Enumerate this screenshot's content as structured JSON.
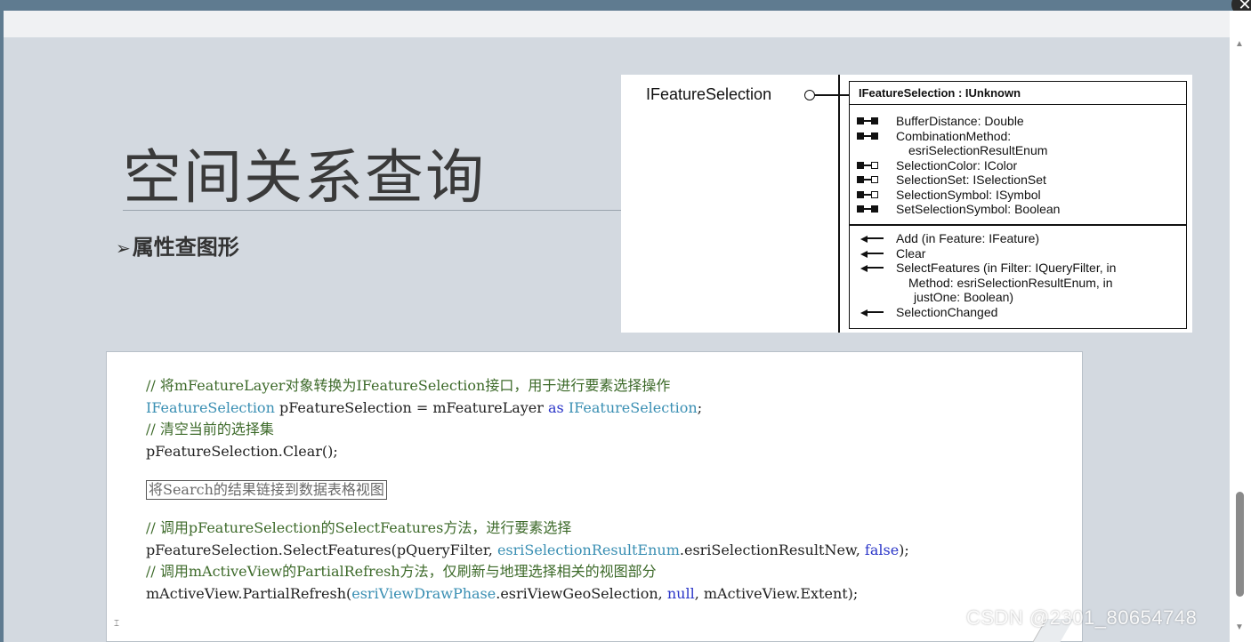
{
  "slide": {
    "title": "空间关系查询",
    "subtitle": "属性查图形",
    "subtitle_marker": "➢"
  },
  "uml": {
    "interface_name": "IFeatureSelection",
    "header": "IFeatureSelection : IUnknown",
    "properties": [
      {
        "text": "BufferDistance: Double",
        "glyph": "read-write"
      },
      {
        "text": "CombinationMethod:",
        "glyph": "read-write"
      },
      {
        "text": "esriSelectionResultEnum",
        "glyph": "none",
        "continuation": true
      },
      {
        "text": "SelectionColor: IColor",
        "glyph": "read-only"
      },
      {
        "text": "SelectionSet: ISelectionSet",
        "glyph": "read-only"
      },
      {
        "text": "SelectionSymbol: ISymbol",
        "glyph": "read-only"
      },
      {
        "text": "SetSelectionSymbol: Boolean",
        "glyph": "read-write"
      }
    ],
    "methods": [
      {
        "text": "Add (in Feature: IFeature)",
        "glyph": "method"
      },
      {
        "text": "Clear",
        "glyph": "method"
      },
      {
        "text": "SelectFeatures (in Filter: IQueryFilter, in",
        "glyph": "method"
      },
      {
        "text": "Method: esriSelectionResultEnum, in",
        "glyph": "none",
        "continuation": true
      },
      {
        "text": "justOne: Boolean)",
        "glyph": "none",
        "continuation": true
      },
      {
        "text": "SelectionChanged",
        "glyph": "method"
      }
    ]
  },
  "code": {
    "line1_comment": "// 将mFeatureLayer对象转换为IFeatureSelection接口，用于进行要素选择操作",
    "line2_type1": "IFeatureSelection",
    "line2_mid": " pFeatureSelection = mFeatureLayer ",
    "line2_kw": "as",
    "line2_space": " ",
    "line2_type2": "IFeatureSelection",
    "line2_end": ";",
    "line3_comment": "// 清空当前的选择集",
    "line4": "pFeatureSelection.Clear();",
    "search_box": "将Search的结果链接到数据表格视图",
    "line5_comment": "// 调用pFeatureSelection的SelectFeatures方法，进行要素选择",
    "line6_a": "pFeatureSelection.SelectFeatures(pQueryFilter, ",
    "line6_type": "esriSelectionResultEnum",
    "line6_b": ".esriSelectionResultNew, ",
    "line6_kw": "false",
    "line6_end": ");",
    "line7_comment": "// 调用mActiveView的PartialRefresh方法，仅刷新与地理选择相关的视图部分",
    "line8_a": "mActiveView.PartialRefresh(",
    "line8_type": "esriViewDrawPhase",
    "line8_b": ".esriViewGeoSelection, ",
    "line8_kw": "null",
    "line8_end": ", mActiveView.Extent);"
  },
  "watermark": "CSDN @2301_80654748",
  "colors": {
    "frame": "#5f7b90",
    "slide_bg": "#d3d9e0",
    "comment": "#3d6a2a",
    "keyword": "#2a35c8",
    "type": "#3a8fb3"
  }
}
